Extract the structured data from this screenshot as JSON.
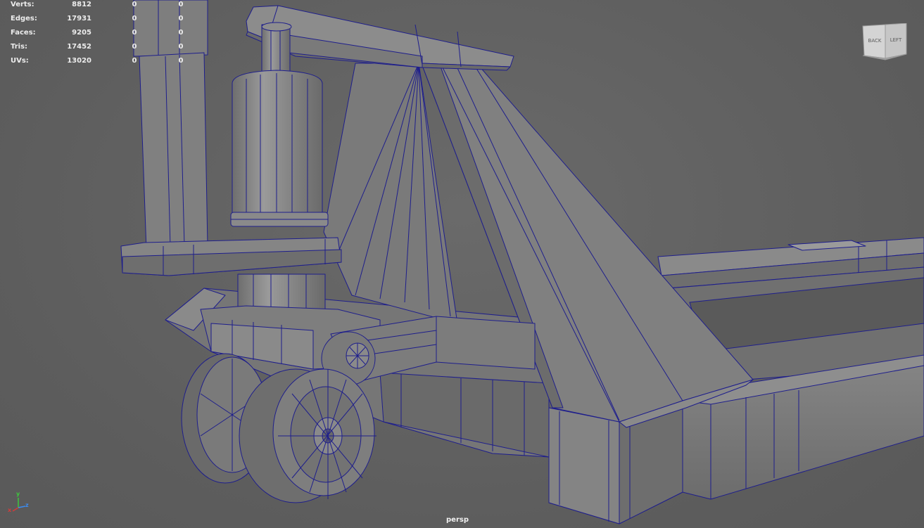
{
  "hud": {
    "rows": [
      {
        "label": "Verts:",
        "value": "8812",
        "sel1": "0",
        "sel2": "0"
      },
      {
        "label": "Edges:",
        "value": "17931",
        "sel1": "0",
        "sel2": "0"
      },
      {
        "label": "Faces:",
        "value": "9205",
        "sel1": "0",
        "sel2": "0"
      },
      {
        "label": "Tris:",
        "value": "17452",
        "sel1": "0",
        "sel2": "0"
      },
      {
        "label": "UVs:",
        "value": "13020",
        "sel1": "0",
        "sel2": "0"
      }
    ]
  },
  "view_cube": {
    "back_label": "BACK",
    "left_label": "LEFT"
  },
  "camera": {
    "name": "persp"
  },
  "axis_gizmo": {
    "x_label": "x",
    "y_label": "y",
    "z_label": "z"
  },
  "colors": {
    "background": "#5f5f5f",
    "wireframe": "#1e1e8c",
    "surface_light": "#8a8a8a",
    "surface_mid": "#7a7a7a",
    "surface_dark": "#555555",
    "hud_text": "#ececec",
    "axis_x": "#d23c3c",
    "axis_y": "#3cc83c",
    "axis_z": "#3c8cf0"
  }
}
